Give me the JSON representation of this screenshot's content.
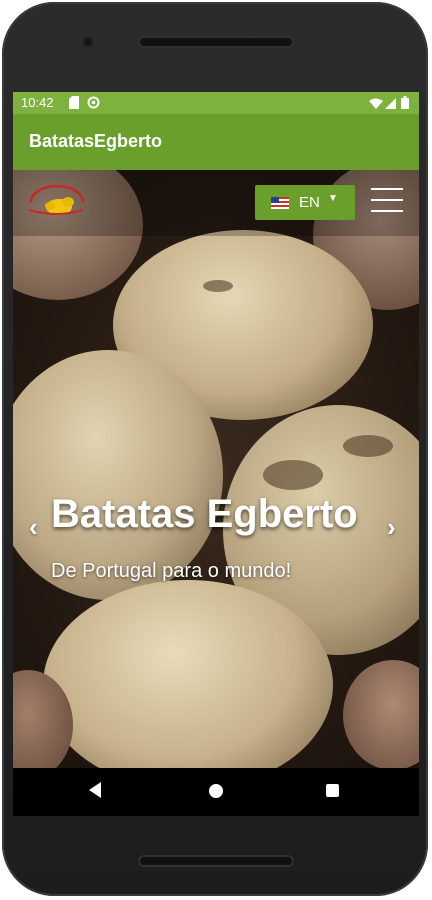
{
  "status_bar": {
    "time": "10:42",
    "icons": [
      "sd-card-icon",
      "sync-icon",
      "wifi-icon",
      "signal-icon",
      "battery-icon"
    ]
  },
  "app_bar": {
    "title": "BatatasEgberto"
  },
  "header": {
    "logo_alt": "Batatas Egberto logo",
    "language": {
      "flag_icon": "us-flag-icon",
      "label": "EN",
      "caret_icon": "caret-down-icon"
    },
    "menu_icon": "hamburger-menu-icon"
  },
  "carousel": {
    "title": "Batatas Egberto",
    "subtitle": "De Portugal para o mundo!",
    "prev_arrow": "‹",
    "next_arrow": "›"
  },
  "nav_bar": {
    "buttons": [
      "back-icon",
      "home-icon",
      "recents-icon"
    ]
  },
  "colors": {
    "status_bar": "#7db23f",
    "app_bar": "#6a9f2c",
    "language_button": "#6a9f2c"
  }
}
